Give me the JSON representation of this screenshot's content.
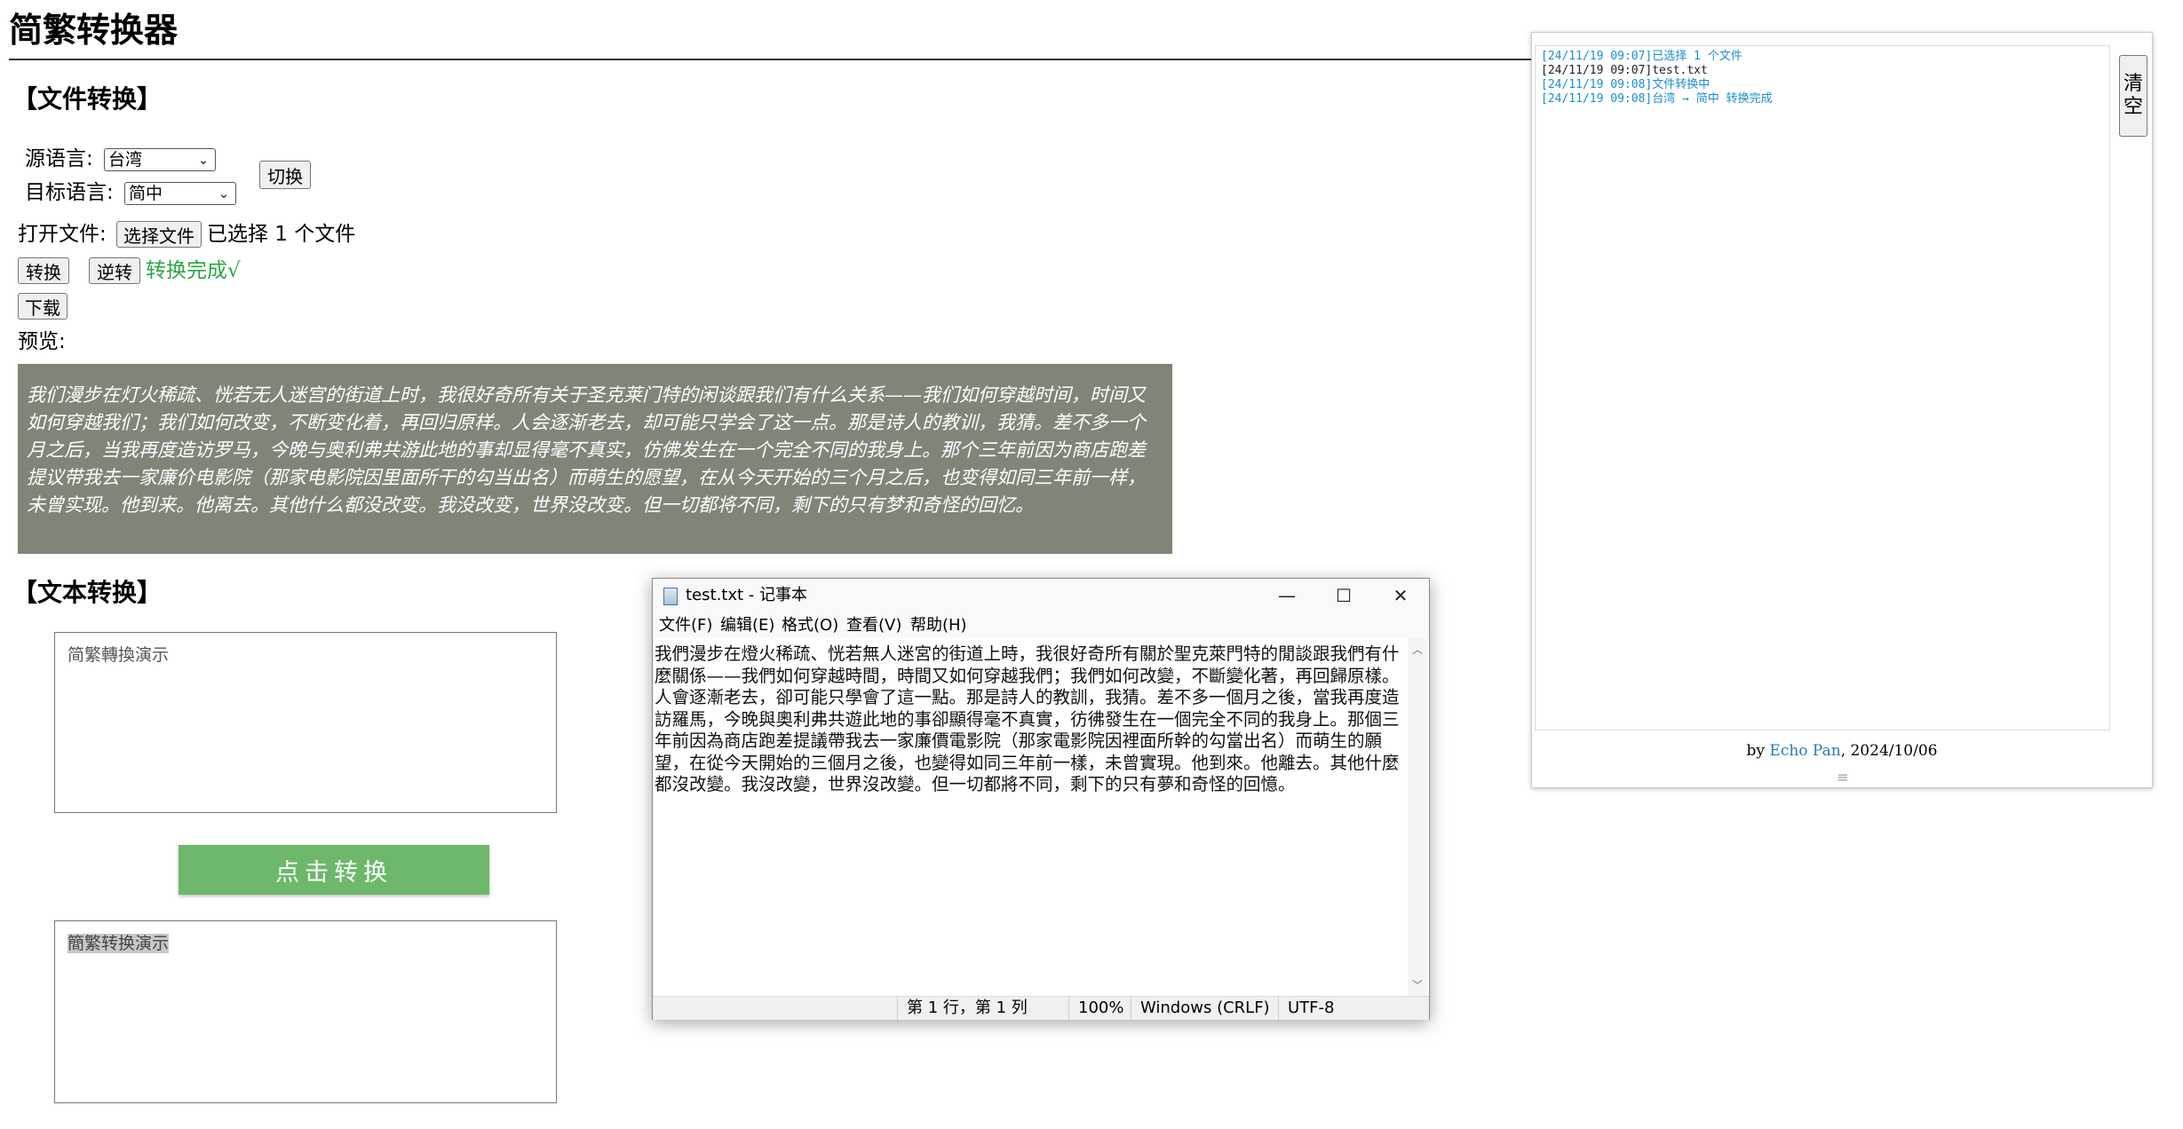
{
  "app": {
    "title": "简繁转换器"
  },
  "file_section": {
    "title": "【文件转换】",
    "source_label": "源语言:",
    "source_value": "台湾",
    "target_label": "目标语言:",
    "target_value": "简中",
    "switch_label": "切换",
    "open_file_label": "打开文件:",
    "choose_file_label": "选择文件",
    "file_status": "已选择 1 个文件",
    "convert_label": "转换",
    "reverse_label": "逆转",
    "done_status": "转换完成√",
    "download_label": "下载",
    "preview_label": "预览:",
    "preview_text": "我们漫步在灯火稀疏、恍若无人迷宫的街道上时，我很好奇所有关于圣克莱门特的闲谈跟我们有什么关系——我们如何穿越时间，时间又如何穿越我们；我们如何改变，不断变化着，再回归原样。人会逐渐老去，却可能只学会了这一点。那是诗人的教训，我猜。差不多一个月之后，当我再度造访罗马，今晚与奥利弗共游此地的事却显得毫不真实，仿佛发生在一个完全不同的我身上。那个三年前因为商店跑差提议带我去一家廉价电影院（那家电影院因里面所干的勾当出名）而萌生的愿望，在从今天开始的三个月之后，也变得如同三年前一样，未曾实现。他到来。他离去。其他什么都没改变。我没改变，世界没改变。但一切都将不同，剩下的只有梦和奇怪的回忆。"
  },
  "text_section": {
    "title": "【文本转换】",
    "input_text": "简繁轉換演示",
    "convert_button": "点击转换",
    "output_text": "簡繁转换演示"
  },
  "log_panel": {
    "entries": [
      "[24/11/19 09:07]已选择 1 个文件",
      "[24/11/19 09:07]test.txt",
      "[24/11/19 09:08]文件转换中",
      "[24/11/19 09:08]台湾 → 简中 转换完成"
    ],
    "entry_colors": [
      "#1a8fd0",
      "#222222",
      "#1a8fd0",
      "#1a8fd0"
    ],
    "clear_label": "清空",
    "credit_prefix": "by ",
    "credit_author": "Echo Pan",
    "credit_date": ", 2024/10/06"
  },
  "notepad": {
    "title": "test.txt - 记事本",
    "menus": [
      "文件(F)",
      "编辑(E)",
      "格式(O)",
      "查看(V)",
      "帮助(H)"
    ],
    "content": "我們漫步在燈火稀疏、恍若無人迷宮的街道上時，我很好奇所有關於聖克萊門特的閒談跟我們有什麼關係——我們如何穿越時間，時間又如何穿越我們；我們如何改變，不斷變化著，再回歸原樣。人會逐漸老去，卻可能只學會了這一點。那是詩人的教訓，我猜。差不多一個月之後，當我再度造訪羅馬，今晚與奧利弗共遊此地的事卻顯得毫不真實，彷彿發生在一個完全不同的我身上。那個三年前因為商店跑差提議帶我去一家廉價電影院（那家電影院因裡面所幹的勾當出名）而萌生的願望，在從今天開始的三個月之後，也變得如同三年前一樣，未曾實現。他到來。他離去。其他什麼都沒改變。我沒改變，世界沒改變。但一切都將不同，剩下的只有夢和奇怪的回憶。",
    "status_position": "第 1 行，第 1 列",
    "status_zoom": "100%",
    "status_eol": "Windows (CRLF)",
    "status_encoding": "UTF-8"
  },
  "colors": {
    "accent_green": "#6db86b",
    "done_green": "#28a745",
    "preview_bg": "#7f8678",
    "log_blue": "#1a8fd0"
  }
}
